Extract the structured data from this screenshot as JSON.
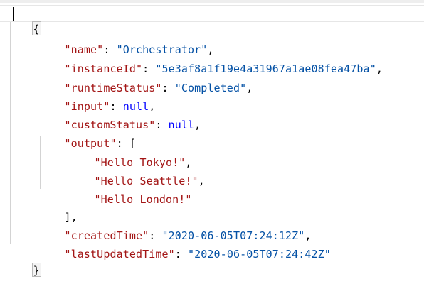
{
  "editor": {
    "open_brace": "{",
    "close_brace": "}",
    "fields": [
      {
        "key": "\"name\"",
        "value": "\"Orchestrator\"",
        "value_type": "string",
        "trail": ","
      },
      {
        "key": "\"instanceId\"",
        "value": "\"5e3af8a1f19e4a31967a1ae08fea47ba\"",
        "value_type": "string",
        "trail": ","
      },
      {
        "key": "\"runtimeStatus\"",
        "value": "\"Completed\"",
        "value_type": "string",
        "trail": ","
      },
      {
        "key": "\"input\"",
        "value": "null",
        "value_type": "keyword",
        "trail": ","
      },
      {
        "key": "\"customStatus\"",
        "value": "null",
        "value_type": "keyword",
        "trail": ","
      }
    ],
    "output": {
      "key": "\"output\"",
      "open_bracket": "[",
      "items": [
        {
          "value": "\"Hello Tokyo!\"",
          "trail": ","
        },
        {
          "value": "\"Hello Seattle!\"",
          "trail": ","
        },
        {
          "value": "\"Hello London!\"",
          "trail": ""
        }
      ],
      "close_bracket": "],"
    },
    "tail_fields": [
      {
        "key": "\"createdTime\"",
        "value": "\"2020-06-05T07:24:12Z\"",
        "value_type": "string",
        "trail": ","
      },
      {
        "key": "\"lastUpdatedTime\"",
        "value": "\"2020-06-05T07:24:42Z\"",
        "value_type": "string",
        "trail": ""
      }
    ],
    "colors": {
      "key": "#a31515",
      "string": "#0451a5",
      "keyword": "#0000ff",
      "punctuation": "#000000"
    }
  }
}
